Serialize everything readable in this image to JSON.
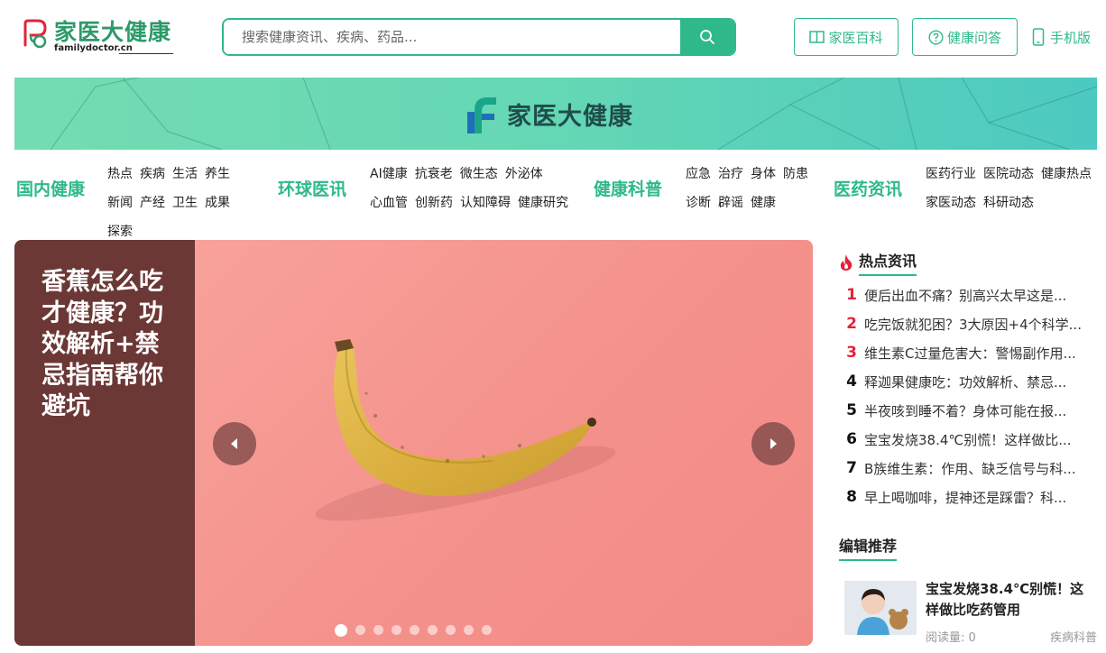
{
  "header": {
    "logo_cn": "家医大健康",
    "logo_en": "familydoctor.cn",
    "search_placeholder": "搜索健康资讯、疾病、药品...",
    "btn_baike": "家医百科",
    "btn_wenda": "健康问答",
    "btn_mobile": "手机版"
  },
  "banner": {
    "brand": "家医大健康"
  },
  "categories": [
    {
      "title": "国内健康",
      "links": [
        "热点",
        "疾病",
        "生活",
        "养生",
        "新闻",
        "产经",
        "卫生",
        "成果",
        "探索"
      ]
    },
    {
      "title": "环球医讯",
      "links": [
        "AI健康",
        "抗衰老",
        "微生态",
        "外泌体",
        "心血管",
        "创新药",
        "认知障碍",
        "健康研究"
      ]
    },
    {
      "title": "健康科普",
      "links": [
        "应急",
        "治疗",
        "身体",
        "防患",
        "诊断",
        "辟谣",
        "健康"
      ]
    },
    {
      "title": "医药资讯",
      "links": [
        "医药行业",
        "医院动态",
        "健康热点",
        "家医动态",
        "科研动态"
      ]
    }
  ],
  "carousel": {
    "caption": "香蕉怎么吃才健康？功效解析+禁忌指南帮你避坑",
    "slide_count": 9,
    "active_index": 0
  },
  "hot": {
    "title": "热点资讯",
    "items": [
      "便后出血不痛？别高兴太早这是...",
      "吃完饭就犯困？3大原因+4个科学...",
      "维生素C过量危害大：警惕副作用...",
      "释迦果健康吃：功效解析、禁忌...",
      "半夜咳到睡不着？身体可能在报...",
      "宝宝发烧38.4℃别慌！这样做比...",
      "B族维生素：作用、缺乏信号与科...",
      "早上喝咖啡，提神还是踩雷？科..."
    ]
  },
  "recommend": {
    "title": "编辑推荐",
    "item_title": "宝宝发烧38.4℃别慌！这样做比吃药管用",
    "reads": "阅读量: 0",
    "category": "疾病科普"
  },
  "colors": {
    "brand": "#2fb98a",
    "hot_red": "#e4223a"
  }
}
